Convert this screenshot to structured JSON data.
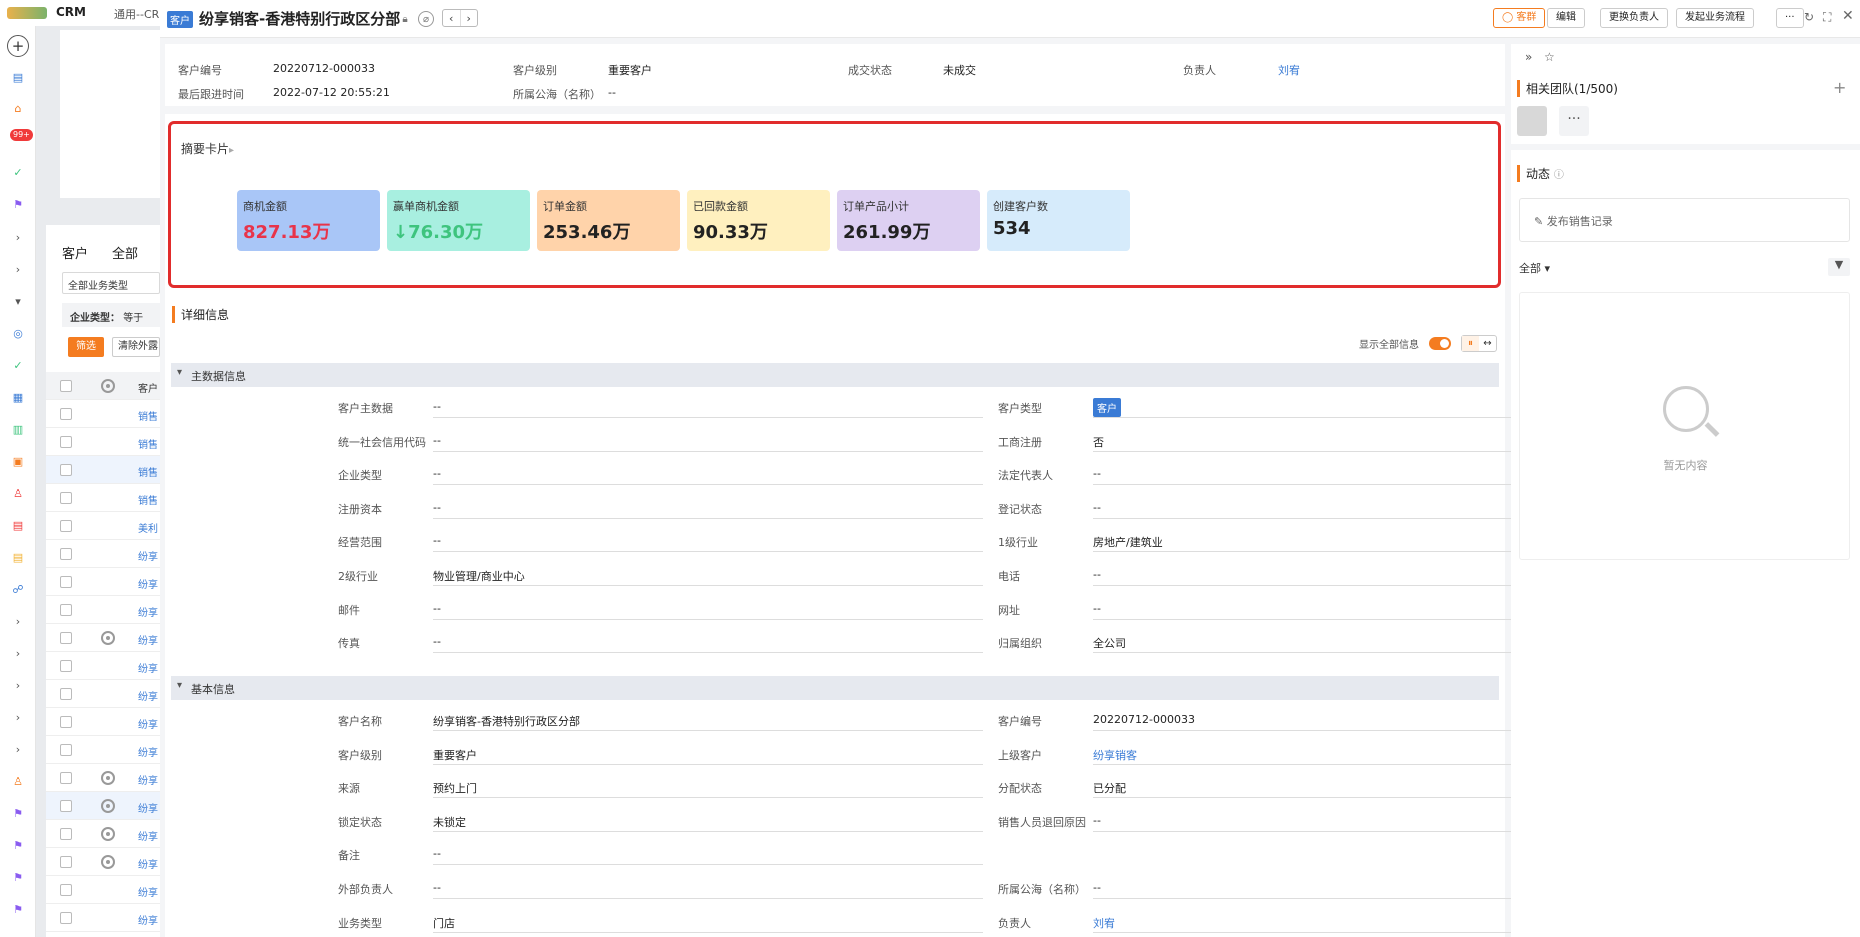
{
  "app": {
    "brand": "CRM",
    "tab": "通用--CR"
  },
  "rail": {
    "badge": "99+"
  },
  "background": {
    "list_title": "客户",
    "filter_all": "全部",
    "biz_type": "全部业务类型",
    "filter_label": "企业类型：",
    "filter_op": "等于",
    "filter_btn": "筛选",
    "clear_btn": "清除外露",
    "col_header": "客户",
    "rows": [
      "销售",
      "销售",
      "销售",
      "销售",
      "美利",
      "纷享",
      "纷享",
      "纷享",
      "纷享",
      "纷享",
      "纷享",
      "纷享",
      "纷享",
      "纷享",
      "纷享",
      "纷享",
      "纷享",
      "纷享",
      "纷享",
      "纷享"
    ]
  },
  "header": {
    "tag": "客户",
    "title": "纷享销客-香港特别行政区分部",
    "btn_group": "客群",
    "btn_edit": "编辑",
    "btn_change_owner": "更换负责人",
    "btn_flow": "发起业务流程",
    "btn_more": "···"
  },
  "summary_info": {
    "customer_no_label": "客户编号",
    "customer_no": "20220712-000033",
    "level_label": "客户级别",
    "level": "重要客户",
    "deal_label": "成交状态",
    "deal": "未成交",
    "owner_label": "负责人",
    "owner": "刘宥",
    "last_follow_label": "最后跟进时间",
    "last_follow": "2022-07-12 20:55:21",
    "pool_label": "所属公海（名称）",
    "pool": "--"
  },
  "summary_card": {
    "title": "摘要卡片",
    "cards": [
      {
        "label": "商机金额",
        "value": "827.13万"
      },
      {
        "label": "赢单商机金额",
        "value": "↓76.30万"
      },
      {
        "label": "订单金额",
        "value": "253.46万"
      },
      {
        "label": "已回款金额",
        "value": "90.33万"
      },
      {
        "label": "订单产品小计",
        "value": "261.99万"
      },
      {
        "label": "创建客户数",
        "value": "534"
      }
    ]
  },
  "detail": {
    "title": "详细信息",
    "show_all": "显示全部信息",
    "group_main": "主数据信息",
    "main_fields": [
      [
        "客户主数据",
        "--",
        "客户类型",
        "客户"
      ],
      [
        "统一社会信用代码",
        "--",
        "工商注册",
        "否"
      ],
      [
        "企业类型",
        "--",
        "法定代表人",
        "--"
      ],
      [
        "注册资本",
        "--",
        "登记状态",
        "--"
      ],
      [
        "经营范围",
        "--",
        "1级行业",
        "房地产/建筑业"
      ],
      [
        "2级行业",
        "物业管理/商业中心",
        "电话",
        "--"
      ],
      [
        "邮件",
        "--",
        "网址",
        "--"
      ],
      [
        "传真",
        "--",
        "归属组织",
        "全公司"
      ]
    ],
    "group_basic": "基本信息",
    "basic_fields": [
      [
        "客户名称",
        "纷享销客-香港特别行政区分部",
        "客户编号",
        "20220712-000033"
      ],
      [
        "客户级别",
        "重要客户",
        "上级客户",
        "纷享销客"
      ],
      [
        "来源",
        "预约上门",
        "分配状态",
        "已分配"
      ],
      [
        "锁定状态",
        "未锁定",
        "销售人员退回原因",
        "--"
      ],
      [
        "备注",
        "--",
        "",
        ""
      ],
      [
        "外部负责人",
        "--",
        "所属公海（名称）",
        "--"
      ],
      [
        "业务类型",
        "门店",
        "负责人",
        "刘宥"
      ]
    ]
  },
  "right": {
    "team_title": "相关团队(1/500)",
    "team_more": "···",
    "activity_title": "动态",
    "publish": "发布销售记录",
    "filter": "全部",
    "empty": "暂无内容"
  },
  "colors": {
    "accent": "#f47c20",
    "link": "#3a7bd5",
    "highlight": "#e12c2c",
    "card_bg": [
      "#a9c6f7",
      "#a8efe0",
      "#ffd3aa",
      "#fff0bf",
      "#ddd0f2",
      "#d6ebfb"
    ],
    "card_value": [
      "#e8344a",
      "#3ec47e",
      "#222222",
      "#222222",
      "#222222",
      "#222222"
    ]
  }
}
